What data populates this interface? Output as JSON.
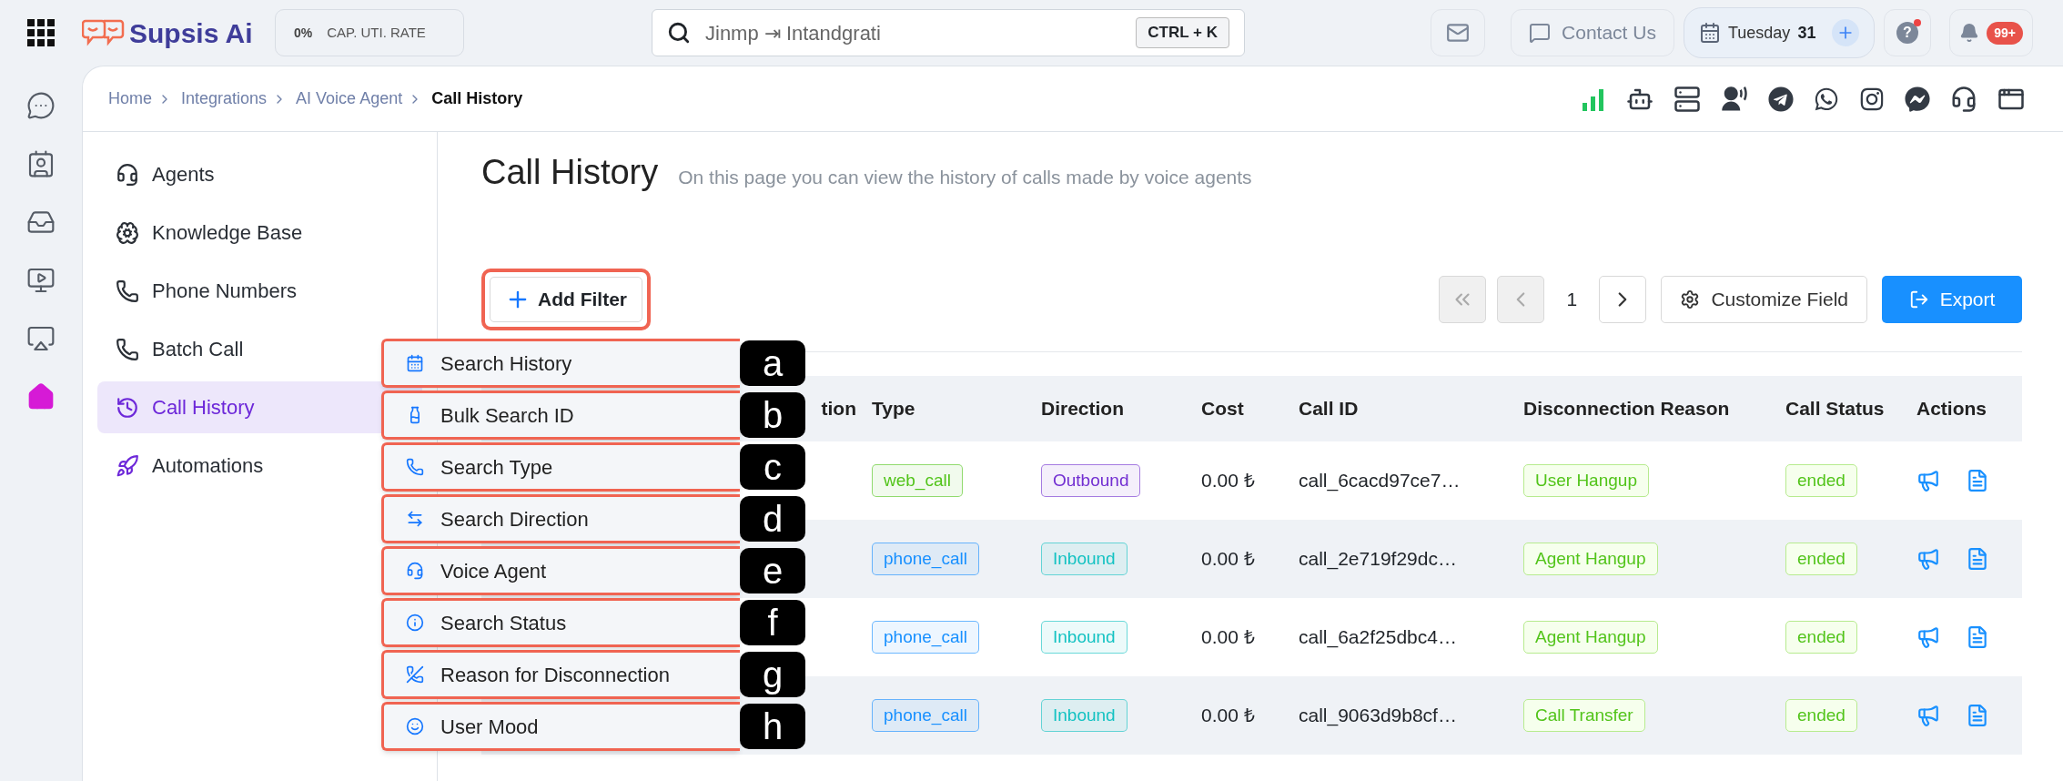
{
  "top_bar": {
    "logo": "Supsis Ai",
    "capacity": {
      "value": "0%",
      "label": "CAP. UTI. RATE"
    },
    "search": {
      "placeholder": "Jinmp ⇥ Intandgrati",
      "shortcut": "CTRL + K"
    },
    "contact": "Contact Us",
    "date": {
      "day": "Tuesday",
      "number": "31"
    },
    "help": {
      "glyph": "?",
      "has_alert": true
    },
    "notifications": "99+"
  },
  "breadcrumb": [
    {
      "label": "Home",
      "current": false
    },
    {
      "label": "Integrations",
      "current": false
    },
    {
      "label": "AI Voice Agent",
      "current": false
    },
    {
      "label": "Call History",
      "current": true
    }
  ],
  "sub_sidebar": [
    {
      "kind": "agents",
      "label": "Agents",
      "selected": false
    },
    {
      "kind": "knowledge",
      "label": "Knowledge Base",
      "selected": false
    },
    {
      "kind": "phone",
      "label": "Phone Numbers",
      "selected": false
    },
    {
      "kind": "batch",
      "label": "Batch Call",
      "selected": false
    },
    {
      "kind": "history",
      "label": "Call History",
      "selected": true
    },
    {
      "kind": "automations",
      "label": "Automations",
      "selected": false
    }
  ],
  "page": {
    "title": "Call History",
    "subtitle": "On this page you can view the history of calls made by voice agents"
  },
  "filter_button": "Add Filter",
  "filter_menu": [
    {
      "kind": "calendar",
      "label": "Search History",
      "marker": "a"
    },
    {
      "kind": "jar",
      "label": "Bulk Search ID",
      "marker": "b"
    },
    {
      "kind": "phone",
      "label": "Search Type",
      "marker": "c"
    },
    {
      "kind": "direction",
      "label": "Search Direction",
      "marker": "d"
    },
    {
      "kind": "agent",
      "label": "Voice Agent",
      "marker": "e"
    },
    {
      "kind": "info",
      "label": "Search Status",
      "marker": "f"
    },
    {
      "kind": "hangup",
      "label": "Reason for Disconnection",
      "marker": "g"
    },
    {
      "kind": "smile",
      "label": "User Mood",
      "marker": "h"
    }
  ],
  "pagination": {
    "first_disabled": true,
    "prev_disabled": true,
    "page": "1",
    "next_disabled": false
  },
  "customize": "Customize Field",
  "export": "Export",
  "table": {
    "columns": [
      "tion",
      "Type",
      "Direction",
      "Cost",
      "Call ID",
      "Disconnection Reason",
      "Call Status",
      "Actions"
    ],
    "rows": [
      {
        "type": {
          "text": "web_call",
          "color": "#52c41a"
        },
        "direction": {
          "text": "Outbound",
          "color": "#722ed1"
        },
        "cost": "0.00 ₺",
        "call_id": "call_6cacd97ce7…",
        "reason": "User Hangup",
        "status": "ended"
      },
      {
        "type": {
          "text": "phone_call",
          "color": "#1890ff"
        },
        "direction": {
          "text": "Inbound",
          "color": "#13c2c2"
        },
        "cost": "0.00 ₺",
        "call_id": "call_2e719f29dc…",
        "reason": "Agent Hangup",
        "status": "ended"
      },
      {
        "type": {
          "text": "phone_call",
          "color": "#1890ff"
        },
        "direction": {
          "text": "Inbound",
          "color": "#13c2c2"
        },
        "cost": "0.00 ₺",
        "call_id": "call_6a2f25dbc4…",
        "reason": "Agent Hangup",
        "status": "ended"
      },
      {
        "type": {
          "text": "phone_call",
          "color": "#1890ff"
        },
        "direction": {
          "text": "Inbound",
          "color": "#13c2c2"
        },
        "cost": "0.00 ₺",
        "call_id": "call_9063d9b8cf…",
        "reason": "Call Transfer",
        "status": "ended"
      }
    ]
  }
}
